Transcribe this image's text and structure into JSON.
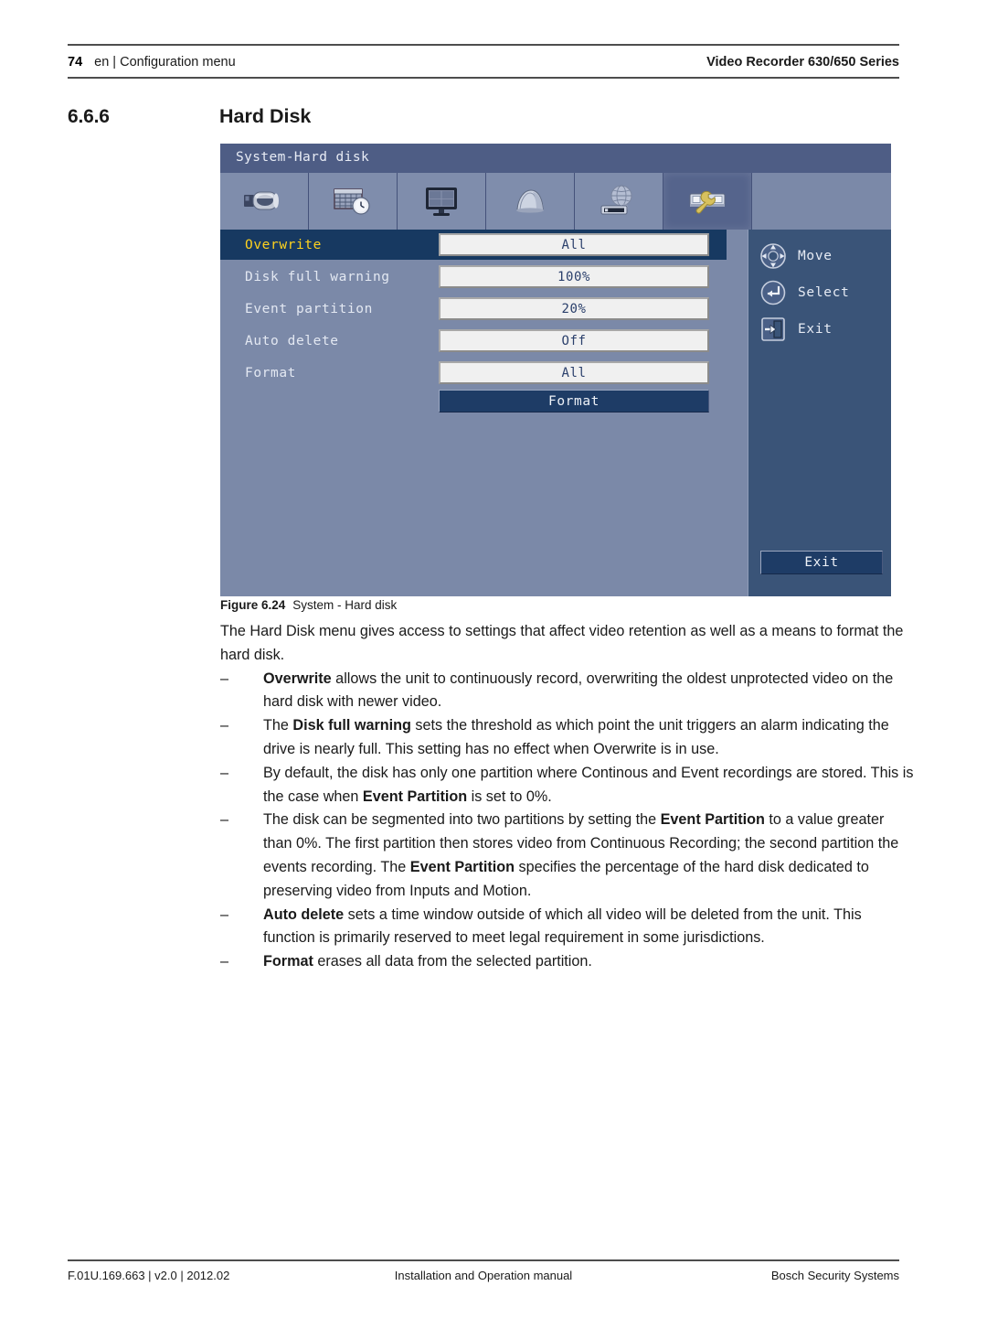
{
  "header": {
    "page_number": "74",
    "left_text": "en | Configuration menu",
    "right_text": "Video Recorder 630/650 Series"
  },
  "section": {
    "number": "6.6.6",
    "title": "Hard Disk"
  },
  "device_ui": {
    "window_title": "System-Hard disk",
    "toolbar": [
      {
        "name": "camera-icon",
        "label": "Camera",
        "active": false
      },
      {
        "name": "schedule-icon",
        "label": "Schedule",
        "active": false
      },
      {
        "name": "display-icon",
        "label": "Display",
        "active": false
      },
      {
        "name": "alarm-icon",
        "label": "Alarm",
        "active": false
      },
      {
        "name": "network-icon",
        "label": "Network",
        "active": false
      },
      {
        "name": "system-icon",
        "label": "System",
        "active": true
      }
    ],
    "settings": [
      {
        "label": "Overwrite",
        "value": "All",
        "selected": true
      },
      {
        "label": "Disk full warning",
        "value": "100%",
        "selected": false
      },
      {
        "label": "Event partition",
        "value": "20%",
        "selected": false
      },
      {
        "label": "Auto delete",
        "value": "Off",
        "selected": false
      },
      {
        "label": "Format",
        "value": "All",
        "selected": false
      }
    ],
    "format_button": "Format",
    "nav": [
      {
        "icon": "dpad-icon",
        "label": "Move"
      },
      {
        "icon": "enter-arrow-icon",
        "label": "Select"
      },
      {
        "icon": "exit-door-icon",
        "label": "Exit"
      }
    ],
    "exit_button": "Exit",
    "colors": {
      "panel_bg": "#7b89a8",
      "titlebar_bg": "#4e5d85",
      "side_panel_bg": "#3a5478",
      "selected_row_bg": "#173961",
      "selected_row_text": "#ffd21e",
      "field_bg": "#f0f0f0",
      "field_text": "#2a3f6b",
      "button_bg": "#1e3c66",
      "wrench_accent": "#d8c15e"
    }
  },
  "figure": {
    "label": "Figure 6.24",
    "caption": "System - Hard disk"
  },
  "body": {
    "intro": "The Hard Disk menu gives access to settings that affect video retention as well as a means to format the hard disk.",
    "bullets": [
      {
        "dash": "–",
        "parts": [
          {
            "text": "Overwrite",
            "bold": true
          },
          {
            "text": " allows the unit to continuously record, overwriting the oldest unprotected video on the hard disk with newer video.",
            "bold": false
          }
        ]
      },
      {
        "dash": "–",
        "parts": [
          {
            "text": "The ",
            "bold": false
          },
          {
            "text": "Disk full warning",
            "bold": true
          },
          {
            "text": " sets the threshold as which point the unit triggers an alarm indicating the drive is nearly full. This setting has no effect when Overwrite is in use.",
            "bold": false
          }
        ]
      },
      {
        "dash": "–",
        "parts": [
          {
            "text": "By default, the disk has only one partition where Continous and Event recordings are stored. This is the case when ",
            "bold": false
          },
          {
            "text": "Event Partition",
            "bold": true
          },
          {
            "text": " is set to 0%.",
            "bold": false
          }
        ]
      },
      {
        "dash": "–",
        "parts": [
          {
            "text": "The disk can be segmented into two partitions by setting the ",
            "bold": false
          },
          {
            "text": "Event Partition",
            "bold": true
          },
          {
            "text": " to a value greater than 0%. The first partition then stores video from Continuous Recording; the second partition the events recording. The ",
            "bold": false
          },
          {
            "text": "Event Partition",
            "bold": true
          },
          {
            "text": " specifies the percentage of the hard disk dedicated to preserving video from Inputs and Motion.",
            "bold": false
          }
        ]
      },
      {
        "dash": "–",
        "parts": [
          {
            "text": "Auto delete",
            "bold": true
          },
          {
            "text": " sets a time window outside of which all video will be deleted from the unit. This function is primarily reserved to meet legal requirement in some jurisdictions.",
            "bold": false
          }
        ]
      },
      {
        "dash": "–",
        "parts": [
          {
            "text": "Format",
            "bold": true
          },
          {
            "text": " erases all data from the selected partition.",
            "bold": false
          }
        ]
      }
    ]
  },
  "footer": {
    "left": "F.01U.169.663 | v2.0 | 2012.02",
    "center": "Installation and Operation manual",
    "right": "Bosch Security Systems"
  }
}
